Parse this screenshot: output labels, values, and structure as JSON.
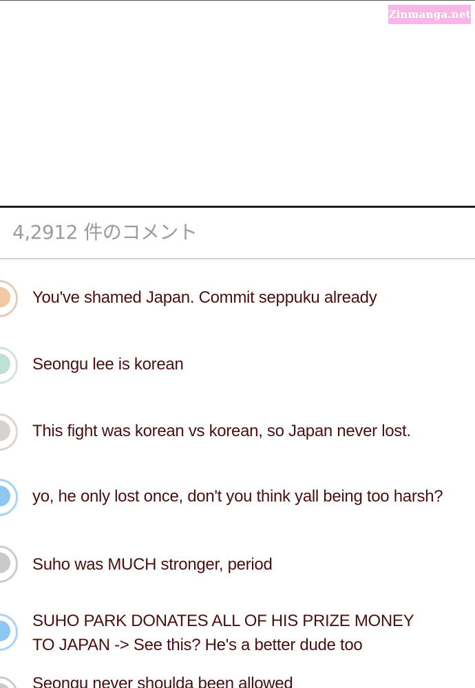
{
  "watermark": {
    "text": "Zinmanga.net",
    "color": "#f6b6e6"
  },
  "comments_header": {
    "count_label": "4,2912 件のコメント"
  },
  "colors": {
    "comment_text": "#4a1010",
    "count_text": "#9b9b9b"
  },
  "comments": [
    {
      "text": "You've shamed Japan. Commit seppuku already",
      "avatar": "avatar-icon",
      "avatar_color": "#f2c9a6",
      "avatar_border": "#e6ccb6"
    },
    {
      "text": "Seongu lee is korean",
      "avatar": "avatar-icon",
      "avatar_color": "#bfe0d4",
      "avatar_border": "#cfe3dc"
    },
    {
      "text": "This fight was korean vs korean, so Japan never lost.",
      "avatar": "avatar-icon",
      "avatar_color": "#d8d2cc",
      "avatar_border": "#dcd6d0"
    },
    {
      "text": "yo, he only lost once, don't you think yall being too harsh?",
      "avatar": "avatar-icon",
      "avatar_color": "#8ec6f2",
      "avatar_border": "#a9d2f4"
    },
    {
      "text": "Suho was MUCH stronger, period",
      "avatar": "avatar-icon",
      "avatar_color": "#c9c9c9",
      "avatar_border": "#cccccc"
    },
    {
      "text": "SUHO PARK DONATES ALL OF HIS PRIZE MONEY\nTO JAPAN -> See this? He's a better dude too",
      "avatar": "avatar-icon",
      "avatar_color": "#8ec6f2",
      "avatar_border": "#a9d2f4"
    },
    {
      "text": "Seongu never shoulda been allowed",
      "avatar": "avatar-icon",
      "avatar_color": "#c9c9c9",
      "avatar_border": "#cccccc"
    }
  ]
}
